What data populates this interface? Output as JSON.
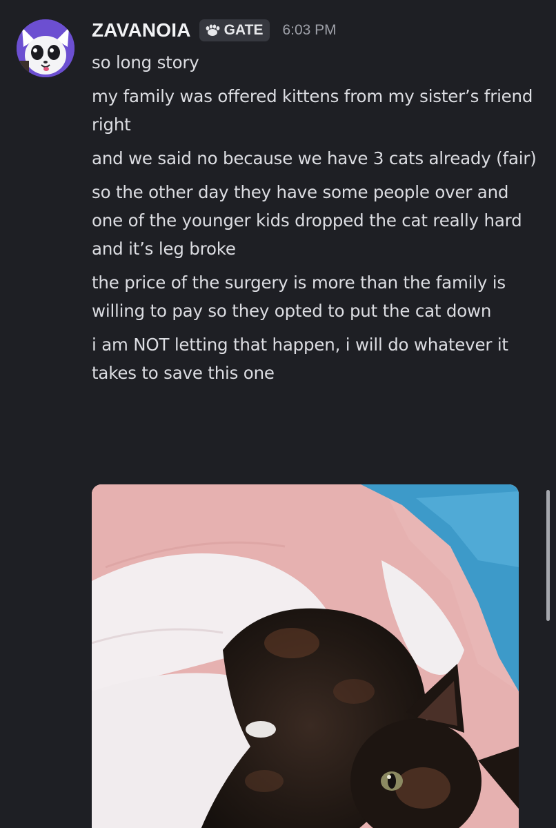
{
  "message": {
    "author": {
      "username": "ZAVANOIA",
      "tag": "GATE",
      "tag_icon": "paw-icon",
      "avatar": "cat-avatar"
    },
    "timestamp": "6:03 PM",
    "lines": [
      "so long story",
      "my family was offered kittens from my sister’s friend right",
      "and we said no because we have 3 cats already (fair)",
      "so the other day they have some people over and one of the younger kids dropped the cat really hard and it’s leg broke",
      "the price of the surgery is more than the family is willing to pay so they opted to put the cat down",
      "i am NOT letting that happen, i will do whatever it takes to save this one"
    ],
    "attachment": {
      "type": "image",
      "subject": "tortoiseshell kitten on pink and white blanket"
    }
  },
  "colors": {
    "background": "#1e1f24",
    "text": "#dcdde2",
    "username": "#f2f3f5",
    "timestamp": "#9ea0a8",
    "tag_bg": "#36383f",
    "avatar_bg": "#6c4fd1"
  }
}
